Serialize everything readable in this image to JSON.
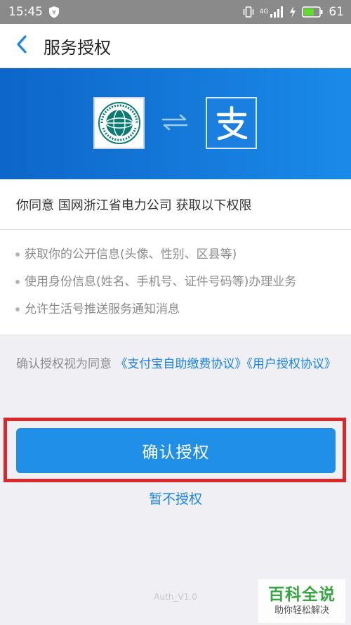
{
  "status_bar": {
    "time": "15:45",
    "network": "4G",
    "battery": "61"
  },
  "header": {
    "title": "服务授权"
  },
  "banner": {
    "icons": [
      "sgcc-logo-icon",
      "swap-arrows-icon",
      "alipay-logo-icon"
    ]
  },
  "agree_line": "你同意 国网浙江省电力公司 获取以下权限",
  "permissions": [
    "获取你的公开信息(头像、性别、区县等)",
    "使用身份信息(姓名、手机号、证件号码等)办理业务",
    "允许生活号推送服务通知消息"
  ],
  "agreement": {
    "prefix": "确认授权视为同意 ",
    "link1": "《支付宝自助缴费协议》",
    "link2": "《用户授权协议》"
  },
  "buttons": {
    "confirm": "确认授权",
    "cancel": "暂不授权"
  },
  "version": "Auth_V1.0",
  "watermark": {
    "main": "百科全说",
    "sub": "助你轻松解决"
  },
  "colors": {
    "accent": "#1f8fe8",
    "link": "#1a84e6",
    "highlight": "#d82a2a",
    "banner": "#1a7ddf"
  }
}
